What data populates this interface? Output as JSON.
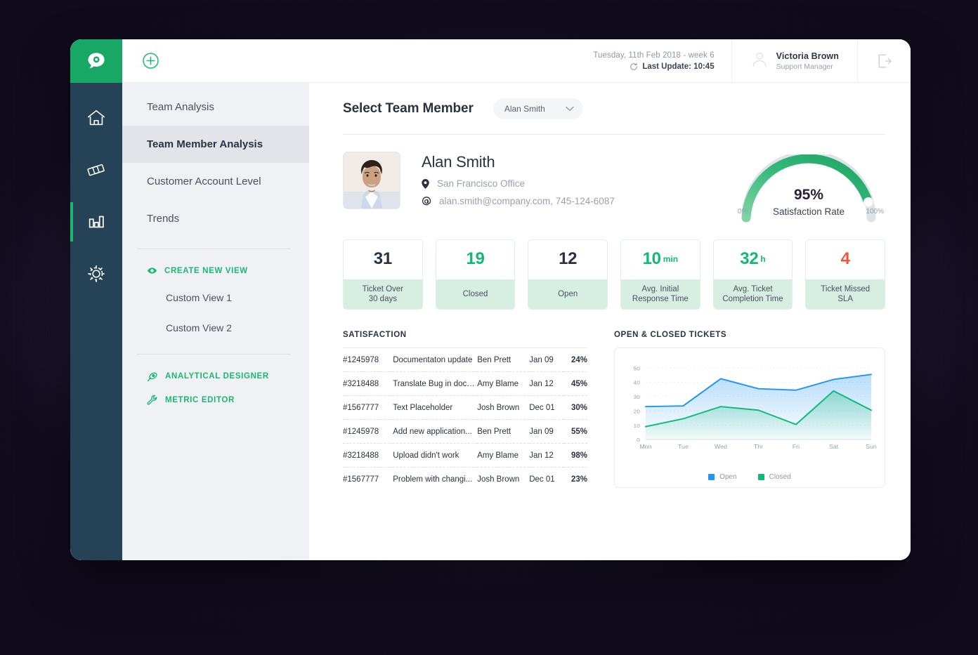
{
  "topbar": {
    "add_icon": "plus-circle-icon",
    "date_text": "Tuesday, 11th Feb 2018 - week 6",
    "last_update": "Last Update: 10:45",
    "refresh_icon": "refresh-icon",
    "user_name": "Victoria Brown",
    "user_role": "Support Manager",
    "logout_icon": "logout-icon"
  },
  "rail": {
    "items": [
      {
        "icon": "home-icon",
        "active": false
      },
      {
        "icon": "tickets-icon",
        "active": false
      },
      {
        "icon": "bar-chart-icon",
        "active": true
      },
      {
        "icon": "gear-icon",
        "active": false
      }
    ]
  },
  "nav": {
    "items": [
      {
        "label": "Team Analysis",
        "active": false
      },
      {
        "label": "Team Member Analysis",
        "active": true
      },
      {
        "label": "Customer Account Level",
        "active": false
      },
      {
        "label": "Trends",
        "active": false
      }
    ],
    "create_new_view": "CREATE NEW VIEW",
    "create_new_view_icon": "eye-icon",
    "custom_views": [
      "Custom View 1",
      "Custom View 2"
    ],
    "analytical_designer": "ANALYTICAL DESIGNER",
    "analytical_designer_icon": "palette-icon",
    "metric_editor": "METRIC EDITOR",
    "metric_editor_icon": "wrench-icon"
  },
  "main": {
    "page_title": "Select Team Member",
    "select_value": "Alan Smith",
    "select_caret_icon": "chevron-down-icon"
  },
  "profile": {
    "photo_alt": "avatar-photo",
    "name": "Alan Smith",
    "location_icon": "location-pin-icon",
    "location": "San Francisco Office",
    "contact_icon": "at-sign-icon",
    "contact": "alan.smith@company.com,  745-124-6087"
  },
  "gauge": {
    "value_text": "95%",
    "value": 95,
    "label": "Satisfaction Rate",
    "min_label": "0%",
    "max_label": "100%",
    "color_start": "#6fcf9a",
    "color_end": "#1fa463",
    "track_color": "#dfe2e6"
  },
  "kpis": [
    {
      "value": "31",
      "unit": "",
      "label": "Ticket Over\n30 days",
      "label_line1": "Ticket Over",
      "label_line2": "30 days",
      "color": "dark"
    },
    {
      "value": "19",
      "unit": "",
      "label_line1": "Closed",
      "label_line2": "",
      "color": "green"
    },
    {
      "value": "12",
      "unit": "",
      "label_line1": "Open",
      "label_line2": "",
      "color": "dark"
    },
    {
      "value": "10",
      "unit": "min",
      "label_line1": "Avg. Initial",
      "label_line2": "Response Time",
      "color": "green"
    },
    {
      "value": "32",
      "unit": "h",
      "label_line1": "Avg. Ticket",
      "label_line2": "Completion Time",
      "color": "green"
    },
    {
      "value": "4",
      "unit": "",
      "label_line1": "Ticket Missed",
      "label_line2": "SLA",
      "color": "red"
    }
  ],
  "satisfaction": {
    "title": "SATISFACTION",
    "rows": [
      {
        "id": "#1245978",
        "subject": "Documentaton update",
        "person": "Ben Prett",
        "date": "Jan 09",
        "pct": "24%",
        "pct_color": "green"
      },
      {
        "id": "#3218488",
        "subject": "Translate Bug in docu...",
        "person": "Amy Blame",
        "date": "Jan 12",
        "pct": "45%",
        "pct_color": "green"
      },
      {
        "id": "#1567777",
        "subject": "Text Placeholder",
        "person": "Josh Brown",
        "date": "Dec 01",
        "pct": "30%",
        "pct_color": "green"
      },
      {
        "id": "#1245978",
        "subject": "Add new application...",
        "person": "Ben Prett",
        "date": "Jan 09",
        "pct": "55%",
        "pct_color": "orange"
      },
      {
        "id": "#3218488",
        "subject": "Upload didn't work",
        "person": "Amy Blame",
        "date": "Jan 12",
        "pct": "98%",
        "pct_color": "red"
      },
      {
        "id": "#1567777",
        "subject": "Problem with changi...",
        "person": "Josh Brown",
        "date": "Dec 01",
        "pct": "23%",
        "pct_color": "green"
      }
    ]
  },
  "tickets_panel": {
    "title": "OPEN & CLOSED TICKETS"
  },
  "chart_data": {
    "type": "area",
    "title": "OPEN & CLOSED TICKETS",
    "categories": [
      "Mon",
      "Tue",
      "Wed",
      "Thr",
      "Fri",
      "Sat",
      "Sun"
    ],
    "series": [
      {
        "name": "Open",
        "color": "#2196f3",
        "values": [
          23,
          23.5,
          42.5,
          35.5,
          34.5,
          42,
          45.5
        ]
      },
      {
        "name": "Closed",
        "color": "#12b976",
        "values": [
          9,
          14.5,
          23,
          20.5,
          10.5,
          34,
          20.5
        ]
      }
    ],
    "ylabel": "",
    "xlabel": "",
    "ylim": [
      0,
      55
    ],
    "yticks": [
      0,
      10,
      20,
      30,
      40,
      50
    ],
    "grid": true,
    "legend_position": "bottom"
  },
  "colors": {
    "brand_green": "#18a866",
    "accent_green": "#12b976",
    "rail_dark": "#264256",
    "nav_bg": "#f0f1f4",
    "red": "#f0563f",
    "orange": "#f5a623",
    "blue": "#2196f3"
  }
}
